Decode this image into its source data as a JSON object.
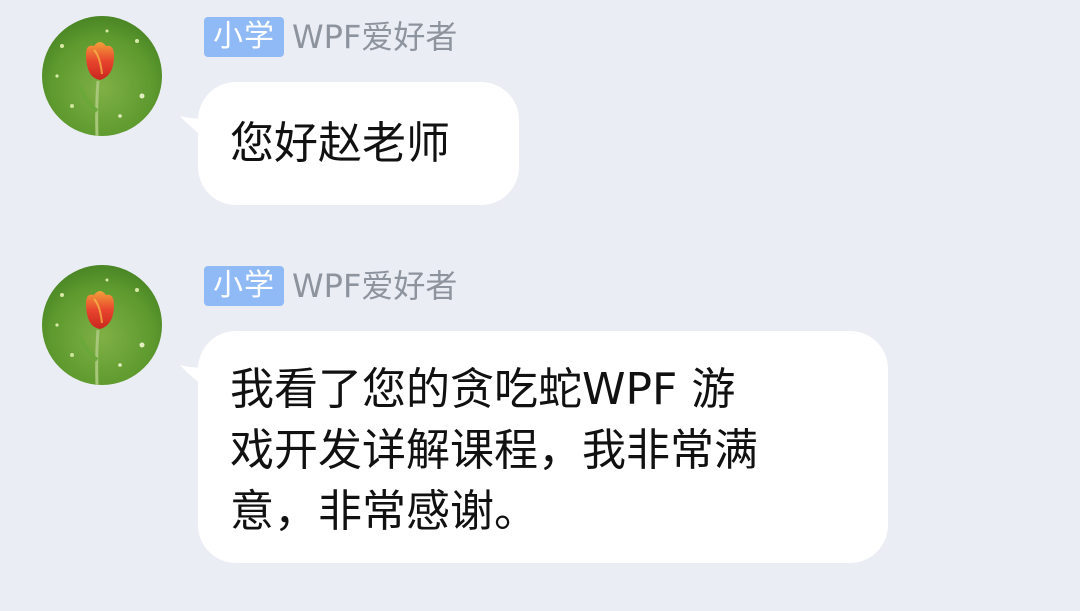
{
  "messages": [
    {
      "badge": "小学",
      "sender": "WPF爱好者",
      "text": "您好赵老师"
    },
    {
      "badge": "小学",
      "sender": "WPF爱好者",
      "text": "我看了您的贪吃蛇WPF 游\n戏开发详解课程，我非常满\n意，非常感谢。"
    }
  ],
  "colors": {
    "background": "#ebedf4",
    "bubble": "#ffffff",
    "badge": "#8fbaf6",
    "sender_name": "#8e949e",
    "text": "#111111"
  },
  "avatar": {
    "icon": "tulip-avatar-icon"
  }
}
